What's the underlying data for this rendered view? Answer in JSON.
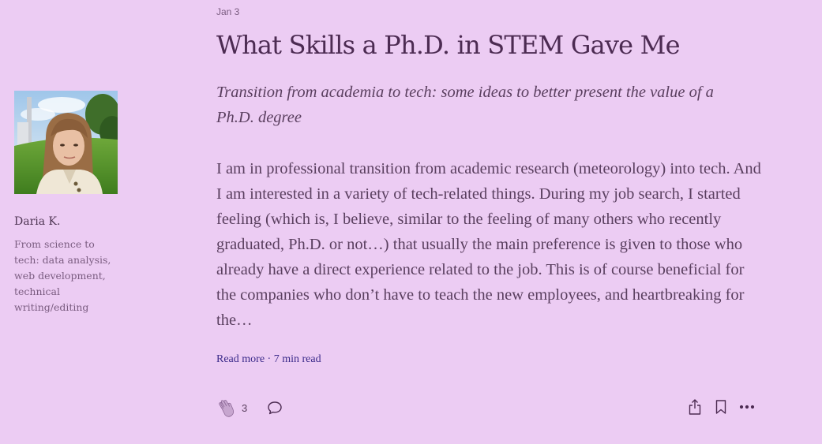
{
  "author": {
    "name": "Daria K.",
    "bio": "From science to tech: data analysis, web development, technical writing/editing"
  },
  "post": {
    "date": "Jan 3",
    "title": "What Skills a Ph.D. in STEM Gave Me",
    "subtitle": "Transition from academia to tech: some ideas to better present the value of a Ph.D. degree",
    "excerpt": "I am in professional transition from academic research (meteorology) into tech. And I am interested in a variety of tech-related things. During my job search, I started feeling (which is, I believe, similar to the feeling of many others who recently graduated, Ph.D. or not…) that usually the main preference is given to those who already have a direct experience related to the job. This is of course beneficial for the companies who don’t have to teach the new employees, and heartbreaking for the…",
    "read_more": "Read more · 7 min read"
  },
  "actions": {
    "clap_count": "3",
    "icons": {
      "clap": "clap-icon",
      "response": "speech-bubble-icon",
      "share": "share-icon",
      "bookmark": "bookmark-icon",
      "more": "more-dots-icon"
    }
  },
  "colors": {
    "background": "#ecccf3",
    "text": "#4c2b52",
    "link": "#3b2a8a"
  }
}
